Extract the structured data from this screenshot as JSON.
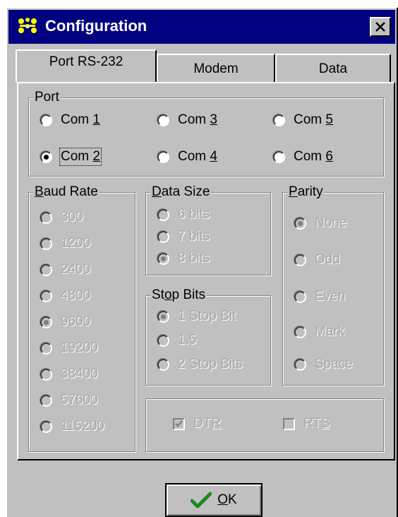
{
  "window": {
    "title": "Configuration"
  },
  "tabs": [
    {
      "label": "Port RS-232",
      "active": true
    },
    {
      "label": "Modem",
      "active": false
    },
    {
      "label": "Data",
      "active": false
    }
  ],
  "port": {
    "label": "Port",
    "options": [
      {
        "pre": "Com ",
        "key": "1",
        "checked": false
      },
      {
        "pre": "Com ",
        "key": "3",
        "checked": false
      },
      {
        "pre": "Com ",
        "key": "5",
        "checked": false
      },
      {
        "pre": "Com ",
        "key": "2",
        "checked": true
      },
      {
        "pre": "Com ",
        "key": "4",
        "checked": false
      },
      {
        "pre": "Com ",
        "key": "6",
        "checked": false
      }
    ]
  },
  "baud": {
    "label_key": "B",
    "label_rest": "aud Rate",
    "options": [
      "300",
      "1200",
      "2400",
      "4800",
      "9600",
      "19200",
      "38400",
      "57600",
      "115200"
    ],
    "selected": "9600"
  },
  "datasize": {
    "label_key": "D",
    "label_rest": "ata Size",
    "options": [
      "6 bits",
      "7 bits",
      "8 bits"
    ],
    "selected": "8 bits"
  },
  "parity": {
    "label_key": "P",
    "label_rest": "arity",
    "options": [
      "None",
      "Odd",
      "Even",
      "Mark",
      "Space"
    ],
    "selected": "None"
  },
  "stopbits": {
    "label_pre": "St",
    "label_key": "o",
    "label_rest": "p Bits",
    "options": [
      "1 Stop Bit",
      "1.5",
      "2 Stop Bits"
    ],
    "selected": "1 Stop Bit"
  },
  "lines": {
    "dtr": {
      "pre": "DT",
      "key": "R",
      "checked": true
    },
    "rts": {
      "pre": "RT",
      "key": "S",
      "checked": false
    }
  },
  "ok": {
    "key": "O",
    "rest": "K"
  }
}
